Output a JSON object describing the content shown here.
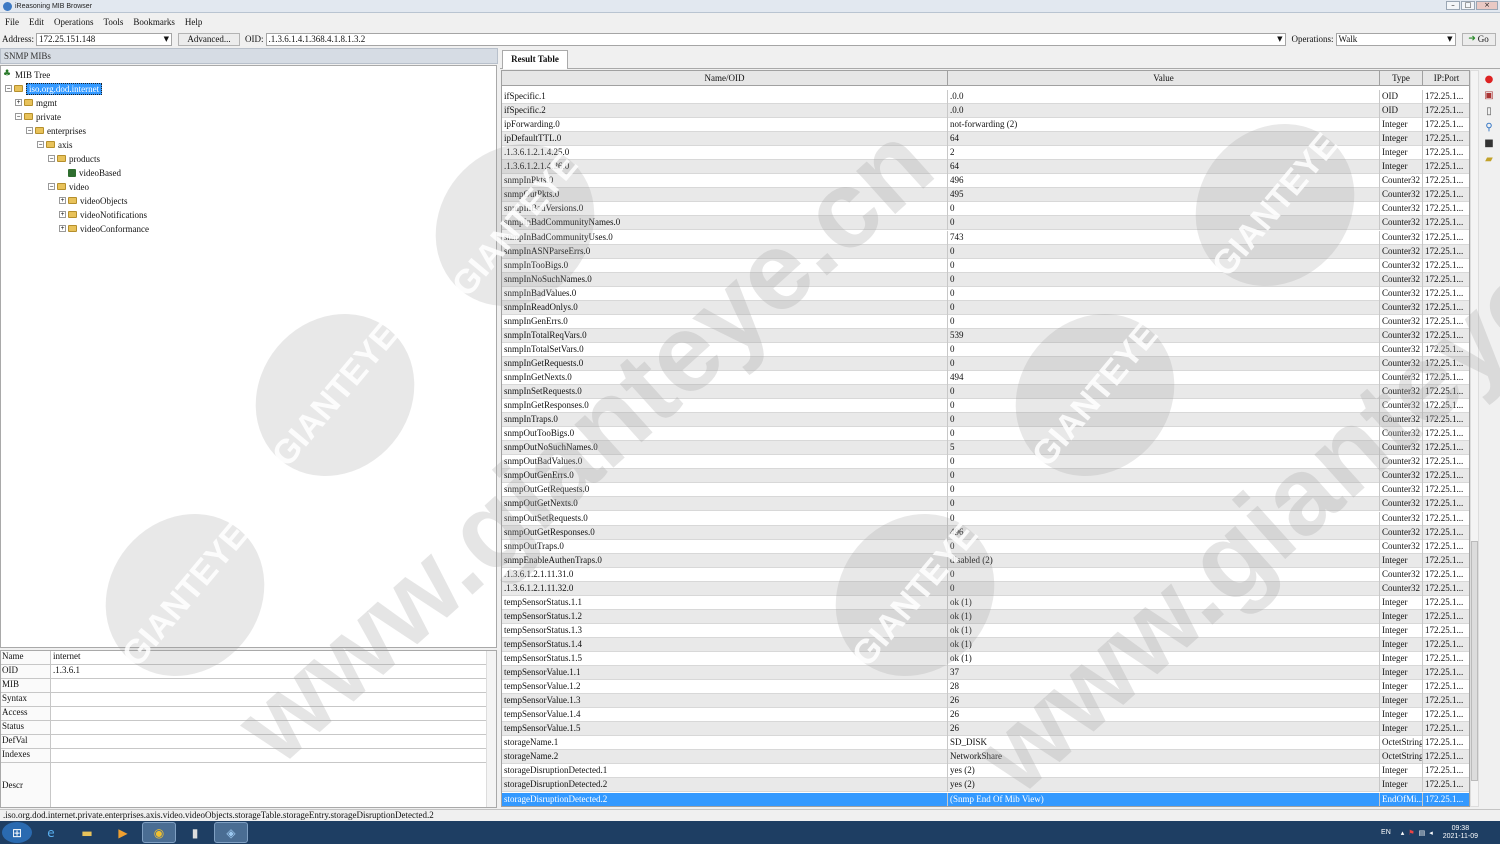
{
  "window": {
    "title": "iReasoning MIB Browser"
  },
  "menu": [
    "File",
    "Edit",
    "Operations",
    "Tools",
    "Bookmarks",
    "Help"
  ],
  "toolbar": {
    "address_label": "Address:",
    "address_value": "172.25.151.148",
    "advanced_label": "Advanced...",
    "oid_label": "OID:",
    "oid_value": ".1.3.6.1.4.1.368.4.1.8.1.3.2",
    "operations_label": "Operations:",
    "operation_value": "Walk",
    "go_label": "Go"
  },
  "left": {
    "header": "SNMP MIBs",
    "tree": {
      "root": "MIB Tree",
      "selected": "iso.org.dod.internet",
      "mgmt": "mgmt",
      "private": "private",
      "enterprises": "enterprises",
      "axis": "axis",
      "products": "products",
      "videoBased": "videoBased",
      "video": "video",
      "videoObjects": "videoObjects",
      "videoNotifications": "videoNotifications",
      "videoConformance": "videoConformance"
    },
    "props": [
      {
        "name": "Name",
        "value": "internet"
      },
      {
        "name": "OID",
        "value": ".1.3.6.1"
      },
      {
        "name": "MIB",
        "value": ""
      },
      {
        "name": "Syntax",
        "value": ""
      },
      {
        "name": "Access",
        "value": ""
      },
      {
        "name": "Status",
        "value": ""
      },
      {
        "name": "DefVal",
        "value": ""
      },
      {
        "name": "Indexes",
        "value": ""
      },
      {
        "name": "Descr",
        "value": ""
      }
    ]
  },
  "right": {
    "tab": "Result Table",
    "columns": {
      "name": "Name/OID",
      "value": "Value",
      "type": "Type",
      "ip": "IP:Port"
    },
    "rows": [
      {
        "n": "ifSpecific.1",
        "v": ".0.0",
        "t": "OID",
        "ip": "172.25.1..."
      },
      {
        "n": "ifSpecific.2",
        "v": ".0.0",
        "t": "OID",
        "ip": "172.25.1..."
      },
      {
        "n": "ipForwarding.0",
        "v": "not-forwarding (2)",
        "t": "Integer",
        "ip": "172.25.1..."
      },
      {
        "n": "ipDefaultTTL.0",
        "v": "64",
        "t": "Integer",
        "ip": "172.25.1..."
      },
      {
        "n": ".1.3.6.1.2.1.4.25.0",
        "v": "2",
        "t": "Integer",
        "ip": "172.25.1..."
      },
      {
        "n": ".1.3.6.1.2.1.4.26.0",
        "v": "64",
        "t": "Integer",
        "ip": "172.25.1..."
      },
      {
        "n": "snmpInPkts.0",
        "v": "496",
        "t": "Counter32",
        "ip": "172.25.1..."
      },
      {
        "n": "snmpOutPkts.0",
        "v": "495",
        "t": "Counter32",
        "ip": "172.25.1..."
      },
      {
        "n": "snmpInBadVersions.0",
        "v": "0",
        "t": "Counter32",
        "ip": "172.25.1..."
      },
      {
        "n": "snmpInBadCommunityNames.0",
        "v": "0",
        "t": "Counter32",
        "ip": "172.25.1..."
      },
      {
        "n": "snmpInBadCommunityUses.0",
        "v": "743",
        "t": "Counter32",
        "ip": "172.25.1..."
      },
      {
        "n": "snmpInASNParseErrs.0",
        "v": "0",
        "t": "Counter32",
        "ip": "172.25.1..."
      },
      {
        "n": "snmpInTooBigs.0",
        "v": "0",
        "t": "Counter32",
        "ip": "172.25.1..."
      },
      {
        "n": "snmpInNoSuchNames.0",
        "v": "0",
        "t": "Counter32",
        "ip": "172.25.1..."
      },
      {
        "n": "snmpInBadValues.0",
        "v": "0",
        "t": "Counter32",
        "ip": "172.25.1..."
      },
      {
        "n": "snmpInReadOnlys.0",
        "v": "0",
        "t": "Counter32",
        "ip": "172.25.1..."
      },
      {
        "n": "snmpInGenErrs.0",
        "v": "0",
        "t": "Counter32",
        "ip": "172.25.1..."
      },
      {
        "n": "snmpInTotalReqVars.0",
        "v": "539",
        "t": "Counter32",
        "ip": "172.25.1..."
      },
      {
        "n": "snmpInTotalSetVars.0",
        "v": "0",
        "t": "Counter32",
        "ip": "172.25.1..."
      },
      {
        "n": "snmpInGetRequests.0",
        "v": "0",
        "t": "Counter32",
        "ip": "172.25.1..."
      },
      {
        "n": "snmpInGetNexts.0",
        "v": "494",
        "t": "Counter32",
        "ip": "172.25.1..."
      },
      {
        "n": "snmpInSetRequests.0",
        "v": "0",
        "t": "Counter32",
        "ip": "172.25.1..."
      },
      {
        "n": "snmpInGetResponses.0",
        "v": "0",
        "t": "Counter32",
        "ip": "172.25.1..."
      },
      {
        "n": "snmpInTraps.0",
        "v": "0",
        "t": "Counter32",
        "ip": "172.25.1..."
      },
      {
        "n": "snmpOutTooBigs.0",
        "v": "0",
        "t": "Counter32",
        "ip": "172.25.1..."
      },
      {
        "n": "snmpOutNoSuchNames.0",
        "v": "5",
        "t": "Counter32",
        "ip": "172.25.1..."
      },
      {
        "n": "snmpOutBadValues.0",
        "v": "0",
        "t": "Counter32",
        "ip": "172.25.1..."
      },
      {
        "n": "snmpOutGenErrs.0",
        "v": "0",
        "t": "Counter32",
        "ip": "172.25.1..."
      },
      {
        "n": "snmpOutGetRequests.0",
        "v": "0",
        "t": "Counter32",
        "ip": "172.25.1..."
      },
      {
        "n": "snmpOutGetNexts.0",
        "v": "0",
        "t": "Counter32",
        "ip": "172.25.1..."
      },
      {
        "n": "snmpOutSetRequests.0",
        "v": "0",
        "t": "Counter32",
        "ip": "172.25.1..."
      },
      {
        "n": "snmpOutGetResponses.0",
        "v": "496",
        "t": "Counter32",
        "ip": "172.25.1..."
      },
      {
        "n": "snmpOutTraps.0",
        "v": "0",
        "t": "Counter32",
        "ip": "172.25.1..."
      },
      {
        "n": "snmpEnableAuthenTraps.0",
        "v": "disabled (2)",
        "t": "Integer",
        "ip": "172.25.1..."
      },
      {
        "n": ".1.3.6.1.2.1.11.31.0",
        "v": "0",
        "t": "Counter32",
        "ip": "172.25.1..."
      },
      {
        "n": ".1.3.6.1.2.1.11.32.0",
        "v": "0",
        "t": "Counter32",
        "ip": "172.25.1..."
      },
      {
        "n": "tempSensorStatus.1.1",
        "v": "ok (1)",
        "t": "Integer",
        "ip": "172.25.1..."
      },
      {
        "n": "tempSensorStatus.1.2",
        "v": "ok (1)",
        "t": "Integer",
        "ip": "172.25.1..."
      },
      {
        "n": "tempSensorStatus.1.3",
        "v": "ok (1)",
        "t": "Integer",
        "ip": "172.25.1..."
      },
      {
        "n": "tempSensorStatus.1.4",
        "v": "ok (1)",
        "t": "Integer",
        "ip": "172.25.1..."
      },
      {
        "n": "tempSensorStatus.1.5",
        "v": "ok (1)",
        "t": "Integer",
        "ip": "172.25.1..."
      },
      {
        "n": "tempSensorValue.1.1",
        "v": "37",
        "t": "Integer",
        "ip": "172.25.1..."
      },
      {
        "n": "tempSensorValue.1.2",
        "v": "28",
        "t": "Integer",
        "ip": "172.25.1..."
      },
      {
        "n": "tempSensorValue.1.3",
        "v": "26",
        "t": "Integer",
        "ip": "172.25.1..."
      },
      {
        "n": "tempSensorValue.1.4",
        "v": "26",
        "t": "Integer",
        "ip": "172.25.1..."
      },
      {
        "n": "tempSensorValue.1.5",
        "v": "26",
        "t": "Integer",
        "ip": "172.25.1..."
      },
      {
        "n": "storageName.1",
        "v": "SD_DISK",
        "t": "OctetString",
        "ip": "172.25.1..."
      },
      {
        "n": "storageName.2",
        "v": "NetworkShare",
        "t": "OctetString",
        "ip": "172.25.1..."
      },
      {
        "n": "storageDisruptionDetected.1",
        "v": "yes (2)",
        "t": "Integer",
        "ip": "172.25.1..."
      },
      {
        "n": "storageDisruptionDetected.2",
        "v": "yes (2)",
        "t": "Integer",
        "ip": "172.25.1..."
      },
      {
        "n": "storageDisruptionDetected.2",
        "v": "(Snmp End Of Mib View)",
        "t": "EndOfMi...",
        "ip": "172.25.1..."
      }
    ]
  },
  "status": {
    "path": ".iso.org.dod.internet.private.enterprises.axis.video.videoObjects.storageTable.storageEntry.storageDisruptionDetected.2"
  },
  "taskbar": {
    "clock_time": "09:38",
    "clock_date": "2021-11-09",
    "lang": "EN"
  },
  "watermark": {
    "brand": "GIANTEYE",
    "url": "www.gianteye.cn"
  },
  "colors": {
    "selection": "#3399ff",
    "taskbar": "#1e3e63"
  }
}
